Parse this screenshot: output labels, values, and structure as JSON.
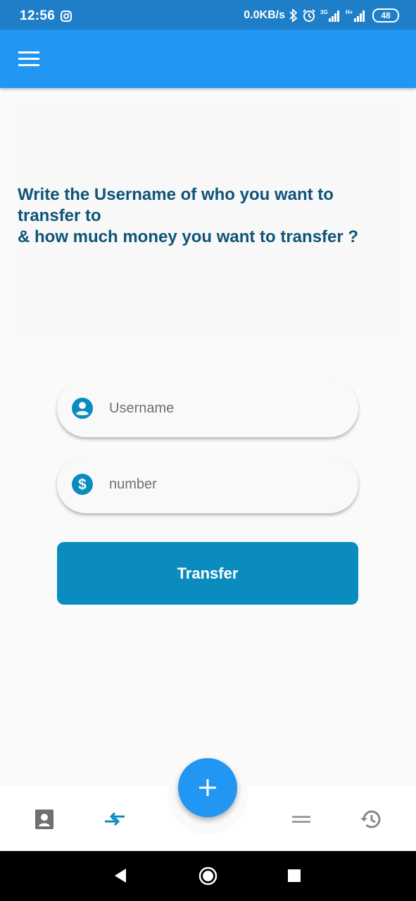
{
  "status_bar": {
    "time": "12:56",
    "net_speed": "0.0KB/s",
    "net_type_1": "3G",
    "net_type_2": "H+",
    "battery": "48"
  },
  "colors": {
    "status_bar": "#1e7fc8",
    "app_bar": "#2196f3",
    "accent": "#0a8cbf",
    "prompt_text": "#0f5478"
  },
  "prompt": {
    "text": "Write the Username of who you want to transfer to\n& how much money you want to transfer ?"
  },
  "form": {
    "username_placeholder": "Username",
    "username_icon": "account-circle-icon",
    "amount_placeholder": "number",
    "amount_icon": "dollar-circle-icon",
    "submit_label": "Transfer"
  },
  "bottom_nav": {
    "items": [
      {
        "icon": "contact-card-icon"
      },
      {
        "icon": "transfer-arrows-icon",
        "active": true
      },
      {
        "icon": "equals-icon"
      },
      {
        "icon": "history-icon"
      }
    ],
    "fab_icon": "plus-icon"
  }
}
